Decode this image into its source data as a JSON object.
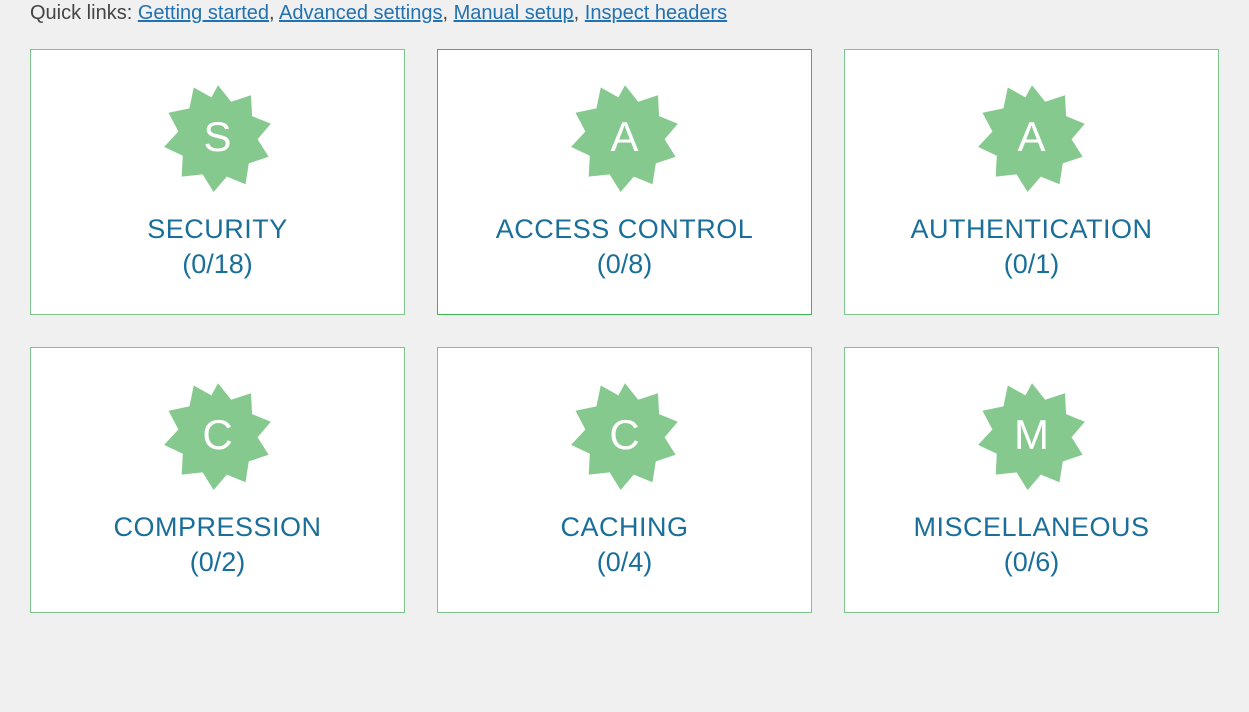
{
  "quickLinks": {
    "prefix": "Quick links:",
    "items": [
      {
        "label": "Getting started"
      },
      {
        "label": "Advanced settings"
      },
      {
        "label": "Manual setup"
      },
      {
        "label": "Inspect headers"
      }
    ]
  },
  "styles": {
    "badgeColor": "#86c98f",
    "titleColor": "#1a6f9a"
  },
  "categories": [
    {
      "letter": "S",
      "title": "SECURITY",
      "count": "(0/18)",
      "highlight": false
    },
    {
      "letter": "A",
      "title": "ACCESS CONTROL",
      "count": "(0/8)",
      "highlight": true
    },
    {
      "letter": "A",
      "title": "AUTHENTICATION",
      "count": "(0/1)",
      "highlight": false
    },
    {
      "letter": "C",
      "title": "COMPRESSION",
      "count": "(0/2)",
      "highlight": false
    },
    {
      "letter": "C",
      "title": "CACHING",
      "count": "(0/4)",
      "highlight": false
    },
    {
      "letter": "M",
      "title": "MISCELLANEOUS",
      "count": "(0/6)",
      "highlight": false
    }
  ]
}
